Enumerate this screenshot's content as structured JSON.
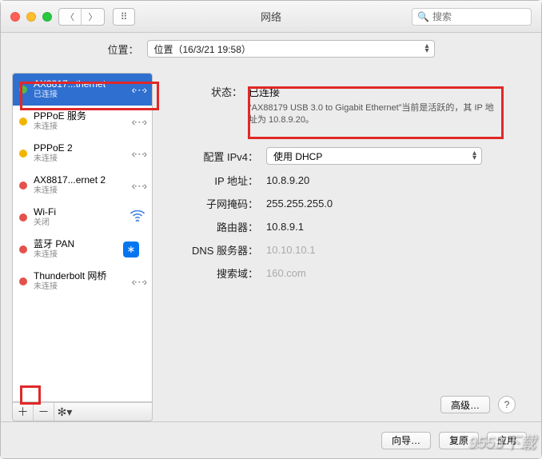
{
  "window": {
    "title": "网络"
  },
  "toolbar": {
    "search_placeholder": "搜索"
  },
  "location": {
    "label": "位置：",
    "value": "位置（16/3/21 19:58）"
  },
  "sidebar": {
    "items": [
      {
        "name": "AX8817...thernet",
        "sub": "已连接",
        "dot": "green",
        "icon": "eth"
      },
      {
        "name": "PPPoE 服务",
        "sub": "未连接",
        "dot": "yellow",
        "icon": "eth"
      },
      {
        "name": "PPPoE 2",
        "sub": "未连接",
        "dot": "yellow",
        "icon": "eth"
      },
      {
        "name": "AX8817...ernet 2",
        "sub": "未连接",
        "dot": "red",
        "icon": "eth"
      },
      {
        "name": "Wi-Fi",
        "sub": "关闭",
        "dot": "red",
        "icon": "wifi"
      },
      {
        "name": "蓝牙 PAN",
        "sub": "未连接",
        "dot": "red",
        "icon": "bt"
      },
      {
        "name": "Thunderbolt 网桥",
        "sub": "未连接",
        "dot": "red",
        "icon": "eth"
      }
    ],
    "tools": {
      "add": "＋",
      "remove": "－",
      "gear": "✻▾"
    }
  },
  "status": {
    "label": "状态：",
    "value": "已连接",
    "desc": "“AX88179 USB 3.0 to Gigabit Ethernet”当前是活跃的，其 IP 地址为 10.8.9.20。"
  },
  "config": {
    "ipv4_label": "配置 IPv4：",
    "ipv4_value": "使用 DHCP",
    "ip_label": "IP 地址：",
    "ip_value": "10.8.9.20",
    "mask_label": "子网掩码：",
    "mask_value": "255.255.255.0",
    "router_label": "路由器：",
    "router_value": "10.8.9.1",
    "dns_label": "DNS 服务器：",
    "dns_value": "10.10.10.1",
    "search_label": "搜索域：",
    "search_value": "160.com"
  },
  "buttons": {
    "advanced": "高级…",
    "wizard": "向导…",
    "revert": "复原",
    "apply": "应用"
  },
  "watermark": "9553下载"
}
